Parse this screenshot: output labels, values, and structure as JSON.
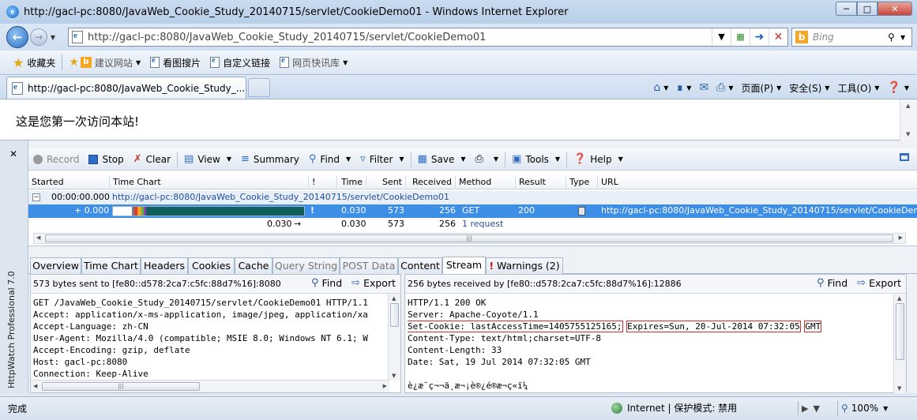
{
  "window": {
    "title": "http://gacl-pc:8080/JavaWeb_Cookie_Study_20140715/servlet/CookieDemo01 - Windows Internet Explorer",
    "minimize": "─",
    "maximize": "□",
    "close": "✕"
  },
  "address_bar": {
    "url": "http://gacl-pc:8080/JavaWeb_Cookie_Study_20140715/servlet/CookieDemo01",
    "search_placeholder": "Bing"
  },
  "favorites_bar": {
    "favorites_label": "收藏夹",
    "items": [
      {
        "label": "建议网站"
      },
      {
        "label": "看图搜片"
      },
      {
        "label": "自定义链接"
      },
      {
        "label": "网页快讯库"
      }
    ]
  },
  "tab": {
    "label": "http://gacl-pc:8080/JavaWeb_Cookie_Study_..."
  },
  "command_bar": {
    "page": "页面(P)",
    "safety": "安全(S)",
    "tools": "工具(O)"
  },
  "page_content": {
    "text": "这是您第一次访问本站!"
  },
  "httpwatch": {
    "product": "HttpWatch Professional 7.0",
    "toolbar": {
      "record": "Record",
      "stop": "Stop",
      "clear": "Clear",
      "view": "View",
      "summary": "Summary",
      "find": "Find",
      "filter": "Filter",
      "save": "Save",
      "tools": "Tools",
      "help": "Help"
    },
    "columns": {
      "started": "Started",
      "time_chart": "Time Chart",
      "bang": "!",
      "time": "Time",
      "sent": "Sent",
      "received": "Received",
      "method": "Method",
      "result": "Result",
      "type": "Type",
      "url": "URL"
    },
    "page_row": {
      "started": "00:00:00.000",
      "url": "http://gacl-pc:8080/JavaWeb_Cookie_Study_20140715/servlet/CookieDemo01"
    },
    "request_row": {
      "started": "+ 0.000",
      "bang": "!",
      "time": "0.030",
      "sent": "573",
      "received": "256",
      "method": "GET",
      "result": "200",
      "url": "http://gacl-pc:8080/JavaWeb_Cookie_Study_20140715/servlet/CookieDemo01"
    },
    "summary_row": {
      "chart_time": "0.030",
      "time": "0.030",
      "sent": "573",
      "received": "256",
      "count": "1 request"
    },
    "timebar_colors": [
      "#7a7a7a",
      "#e03a2f",
      "#f0a021",
      "#59b34a",
      "#8e44ad",
      "#0f5f5f"
    ],
    "detail_tabs": [
      {
        "label": "Overview"
      },
      {
        "label": "Time Chart"
      },
      {
        "label": "Headers"
      },
      {
        "label": "Cookies"
      },
      {
        "label": "Cache"
      },
      {
        "label": "Query String"
      },
      {
        "label": "POST Data"
      },
      {
        "label": "Content"
      },
      {
        "label": "Stream"
      },
      {
        "label": "Warnings (2)"
      }
    ],
    "warning_mark": "!",
    "left_pane": {
      "info": "573 bytes sent to [fe80::d578:2ca7:c5fc:88d7%16]:8080",
      "find": "Find",
      "export": "Export",
      "lines": [
        "GET /JavaWeb_Cookie_Study_20140715/servlet/CookieDemo01 HTTP/1.1",
        "Accept: application/x-ms-application, image/jpeg, application/xa",
        "Accept-Language: zh-CN",
        "User-Agent: Mozilla/4.0 (compatible; MSIE 8.0; Windows NT 6.1; W",
        "Accept-Encoding: gzip, deflate",
        "Host: gacl-pc:8080",
        "Connection: Keep-Alive"
      ]
    },
    "right_pane": {
      "info": "256 bytes received by [fe80::d578:2ca7:c5fc:88d7%16]:12886",
      "find": "Find",
      "export": "Export",
      "lines": [
        "HTTP/1.1 200 OK",
        "Server: Apache-Coyote/1.1",
        "",
        "Content-Type: text/html;charset=UTF-8",
        "Content-Length: 33",
        "Date: Sat, 19 Jul 2014 07:32:05 GMT",
        "",
        "è¿æ¯ç¬¬ä¸æ¬¡è®¿é®æ¬ç«ï¼"
      ],
      "set_cookie": {
        "name_value": "Set-Cookie: lastAccessTime=1405755125165;",
        "expires": "Expires=Sun, 20-Jul-2014 07:32:05",
        "gmt": "GMT"
      }
    }
  },
  "status_bar": {
    "text": "完成",
    "zone": "Internet | 保护模式: 禁用",
    "zoom": "100%"
  }
}
